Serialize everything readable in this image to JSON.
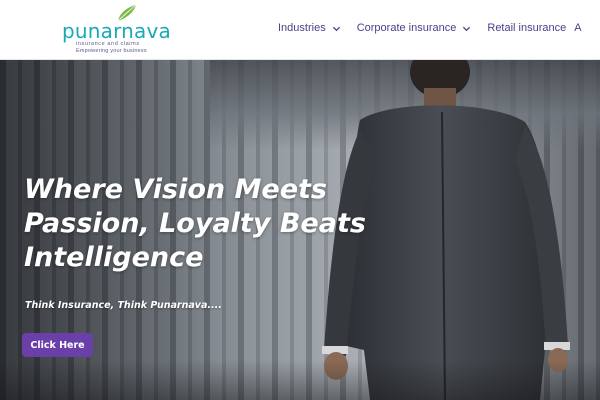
{
  "brand": {
    "name": "punarnava",
    "subline": "insurance and claims",
    "tagline": "Empowering your business",
    "colors": {
      "primary": "#1aa9b6",
      "leaf": "#7dbb4a",
      "nav": "#4b3f8a"
    }
  },
  "nav": {
    "items": [
      {
        "label": "Industries",
        "icon": "chevron-down-icon"
      },
      {
        "label": "Corporate insurance",
        "icon": "chevron-down-icon"
      },
      {
        "label": "Retail insurance"
      }
    ],
    "overflow_label": "A"
  },
  "hero": {
    "title_lines": [
      "Where Vision Meets",
      "Passion, Loyalty Beats",
      "Intelligence"
    ],
    "subtitle": "Think Insurance, Think Punarnava....",
    "cta_label": "Click Here",
    "cta_color": "#6a3fa8"
  }
}
